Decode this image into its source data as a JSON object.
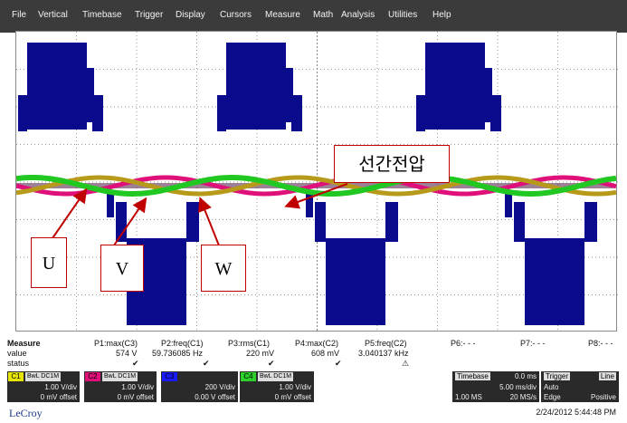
{
  "menu": [
    "File",
    "Vertical",
    "Timebase",
    "Trigger",
    "Display",
    "Cursors",
    "Measure",
    "Math",
    "Analysis",
    "Utilities",
    "Help"
  ],
  "callouts": {
    "line_voltage": "선간전압",
    "u": "U",
    "v": "V",
    "w": "W"
  },
  "measure": {
    "row_labels": [
      "Measure",
      "value",
      "status"
    ],
    "params": [
      {
        "name": "P1:max(C3)",
        "value": "574 V",
        "status": "✔"
      },
      {
        "name": "P2:freq(C1)",
        "value": "59.736085 Hz",
        "status": "✔"
      },
      {
        "name": "P3:rms(C1)",
        "value": "220 mV",
        "status": "✔"
      },
      {
        "name": "P4:max(C2)",
        "value": "608 mV",
        "status": "✔"
      },
      {
        "name": "P5:freq(C2)",
        "value": "3.040137 kHz",
        "status": "⚠"
      },
      {
        "name": "P6:- - -",
        "value": "",
        "status": ""
      },
      {
        "name": "P7:- - -",
        "value": "",
        "status": ""
      },
      {
        "name": "P8:- - -",
        "value": "",
        "status": ""
      }
    ]
  },
  "channels": [
    {
      "tag": "C1",
      "bw": "BwL DC1M",
      "scale": "1.00 V/div",
      "offset": "0 mV offset",
      "color": "#e6e600"
    },
    {
      "tag": "C2",
      "bw": "BwL DC1M",
      "scale": "1.00 V/div",
      "offset": "0 mV offset",
      "color": "#e0107a"
    },
    {
      "tag": "C3",
      "bw": "",
      "scale": "200 V/div",
      "offset": "0.00 V offset",
      "color": "#1a1aff"
    },
    {
      "tag": "C4",
      "bw": "BwL DC1M",
      "scale": "1.00 V/div",
      "offset": "0 mV offset",
      "color": "#2cd12c"
    }
  ],
  "timebase": {
    "title": "Timebase",
    "delay": "0.0 ms",
    "tdiv": "5.00 ms/div",
    "samples": "1.00 MS",
    "rate": "20 MS/s"
  },
  "trigger": {
    "title": "Trigger",
    "mode_badge": "Line",
    "mode": "Auto",
    "type": "Edge",
    "slope": "Positive"
  },
  "brand": "LeCroy",
  "datetime": "2/24/2012 5:44:48 PM",
  "colors": {
    "c1": "#b79a1a",
    "c2": "#e0107a",
    "c3": "#0a0a8c",
    "c4": "#22c822"
  }
}
